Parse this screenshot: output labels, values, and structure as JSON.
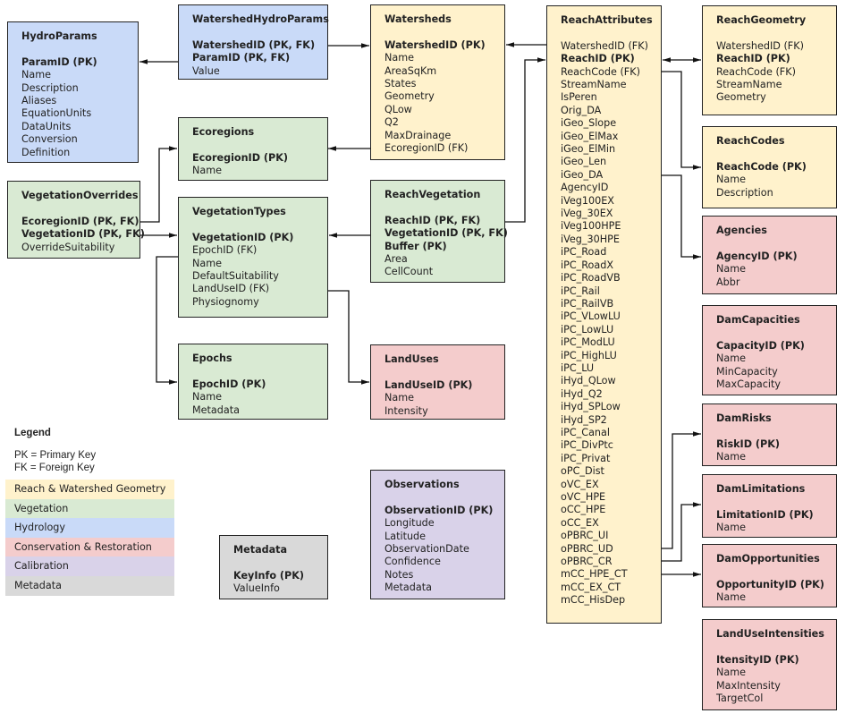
{
  "tables": {
    "hydroparams": {
      "title": "HydroParams",
      "fields": [
        {
          "name": "ParamID (PK)",
          "key": true
        },
        {
          "name": "Name"
        },
        {
          "name": "Description"
        },
        {
          "name": "Aliases"
        },
        {
          "name": "EquationUnits"
        },
        {
          "name": "DataUnits"
        },
        {
          "name": "Conversion"
        },
        {
          "name": "Definition"
        }
      ],
      "category": "hydrology"
    },
    "watershedhydroparams": {
      "title": "WatershedHydroParams",
      "fields": [
        {
          "name": "WatershedID (PK, FK)",
          "key": true
        },
        {
          "name": "ParamID (PK, FK)",
          "key": true
        },
        {
          "name": "Value"
        }
      ],
      "category": "hydrology"
    },
    "watersheds": {
      "title": "Watersheds",
      "fields": [
        {
          "name": "WatershedID (PK)",
          "key": true
        },
        {
          "name": "Name"
        },
        {
          "name": "AreaSqKm"
        },
        {
          "name": "States"
        },
        {
          "name": "Geometry"
        },
        {
          "name": "QLow"
        },
        {
          "name": "Q2"
        },
        {
          "name": "MaxDrainage"
        },
        {
          "name": "EcoregionID (FK)"
        }
      ],
      "category": "geometry"
    },
    "reachattributes": {
      "title": "ReachAttributes",
      "fields": [
        {
          "name": "WatershedID (FK)"
        },
        {
          "name": "ReachID (PK)",
          "key": true
        },
        {
          "name": "ReachCode (FK)"
        },
        {
          "name": "StreamName"
        },
        {
          "name": "IsPeren"
        },
        {
          "name": "Orig_DA"
        },
        {
          "name": "iGeo_Slope"
        },
        {
          "name": "iGeo_ElMax"
        },
        {
          "name": "iGeo_ElMin"
        },
        {
          "name": "iGeo_Len"
        },
        {
          "name": "iGeo_DA"
        },
        {
          "name": "AgencyID"
        },
        {
          "name": "iVeg100EX"
        },
        {
          "name": "iVeg_30EX"
        },
        {
          "name": "iVeg100HPE"
        },
        {
          "name": "iVeg_30HPE"
        },
        {
          "name": "iPC_Road"
        },
        {
          "name": "iPC_RoadX"
        },
        {
          "name": "iPC_RoadVB"
        },
        {
          "name": "iPC_Rail"
        },
        {
          "name": "iPC_RailVB"
        },
        {
          "name": "iPC_VLowLU"
        },
        {
          "name": "iPC_LowLU"
        },
        {
          "name": "iPC_ModLU"
        },
        {
          "name": "iPC_HighLU"
        },
        {
          "name": "iPC_LU"
        },
        {
          "name": "iHyd_QLow"
        },
        {
          "name": "iHyd_Q2"
        },
        {
          "name": "iHyd_SPLow"
        },
        {
          "name": "iHyd_SP2"
        },
        {
          "name": "iPC_Canal"
        },
        {
          "name": "iPC_DivPtc"
        },
        {
          "name": "iPC_Privat"
        },
        {
          "name": "oPC_Dist"
        },
        {
          "name": "oVC_EX"
        },
        {
          "name": "oVC_HPE"
        },
        {
          "name": "oCC_HPE"
        },
        {
          "name": "oCC_EX"
        },
        {
          "name": "oPBRC_UI"
        },
        {
          "name": "oPBRC_UD"
        },
        {
          "name": "oPBRC_CR"
        },
        {
          "name": "mCC_HPE_CT"
        },
        {
          "name": "mCC_EX_CT"
        },
        {
          "name": "mCC_HisDep"
        }
      ],
      "category": "geometry"
    },
    "reachgeometry": {
      "title": "ReachGeometry",
      "fields": [
        {
          "name": "WatershedID (FK)"
        },
        {
          "name": "ReachID (PK)",
          "key": true
        },
        {
          "name": "ReachCode (FK)"
        },
        {
          "name": "StreamName"
        },
        {
          "name": "Geometry"
        }
      ],
      "category": "geometry"
    },
    "reachcodes": {
      "title": "ReachCodes",
      "fields": [
        {
          "name": "ReachCode (PK)",
          "key": true
        },
        {
          "name": "Name"
        },
        {
          "name": "Description"
        }
      ],
      "category": "geometry"
    },
    "agencies": {
      "title": "Agencies",
      "fields": [
        {
          "name": "AgencyID (PK)",
          "key": true
        },
        {
          "name": "Name"
        },
        {
          "name": "Abbr"
        }
      ],
      "category": "conservation"
    },
    "damcapacities": {
      "title": "DamCapacities",
      "fields": [
        {
          "name": "CapacityID (PK)",
          "key": true
        },
        {
          "name": "Name"
        },
        {
          "name": "MinCapacity"
        },
        {
          "name": "MaxCapacity"
        }
      ],
      "category": "conservation"
    },
    "damrisks": {
      "title": "DamRisks",
      "fields": [
        {
          "name": "RiskID (PK)",
          "key": true
        },
        {
          "name": "Name"
        }
      ],
      "category": "conservation"
    },
    "damlimitations": {
      "title": "DamLimitations",
      "fields": [
        {
          "name": "LimitationID (PK)",
          "key": true
        },
        {
          "name": "Name"
        }
      ],
      "category": "conservation"
    },
    "damopportunities": {
      "title": "DamOpportunities",
      "fields": [
        {
          "name": "OpportunityID (PK)",
          "key": true
        },
        {
          "name": "Name"
        }
      ],
      "category": "conservation"
    },
    "landuseintensities": {
      "title": "LandUseIntensities",
      "fields": [
        {
          "name": "ItensityID (PK)",
          "key": true
        },
        {
          "name": "Name"
        },
        {
          "name": "MaxIntensity"
        },
        {
          "name": "TargetCol"
        }
      ],
      "category": "conservation"
    },
    "ecoregions": {
      "title": "Ecoregions",
      "fields": [
        {
          "name": "EcoregionID (PK)",
          "key": true
        },
        {
          "name": "Name"
        }
      ],
      "category": "vegetation"
    },
    "vegetationoverrides": {
      "title": "VegetationOverrides",
      "fields": [
        {
          "name": "EcoregionID (PK, FK)",
          "key": true
        },
        {
          "name": "VegetationID (PK, FK)",
          "key": true
        },
        {
          "name": "OverrideSuitability"
        }
      ],
      "category": "vegetation"
    },
    "vegetationtypes": {
      "title": "VegetationTypes",
      "fields": [
        {
          "name": "VegetationID (PK)",
          "key": true
        },
        {
          "name": "EpochID (FK)"
        },
        {
          "name": "Name"
        },
        {
          "name": "DefaultSuitability"
        },
        {
          "name": "LandUseID (FK)"
        },
        {
          "name": "Physiognomy"
        }
      ],
      "category": "vegetation"
    },
    "reachvegetation": {
      "title": "ReachVegetation",
      "fields": [
        {
          "name": "ReachID (PK, FK)",
          "key": true
        },
        {
          "name": "VegetationID (PK, FK)",
          "key": true
        },
        {
          "name": "Buffer (PK)",
          "key": true
        },
        {
          "name": "Area"
        },
        {
          "name": "CellCount"
        }
      ],
      "category": "vegetation"
    },
    "epochs": {
      "title": "Epochs",
      "fields": [
        {
          "name": "EpochID (PK)",
          "key": true
        },
        {
          "name": "Name"
        },
        {
          "name": "Metadata"
        }
      ],
      "category": "vegetation"
    },
    "landuses": {
      "title": "LandUses",
      "fields": [
        {
          "name": "LandUseID (PK)",
          "key": true
        },
        {
          "name": "Name"
        },
        {
          "name": "Intensity"
        }
      ],
      "category": "conservation"
    },
    "observations": {
      "title": "Observations",
      "fields": [
        {
          "name": "ObservationID (PK)",
          "key": true
        },
        {
          "name": "Longitude"
        },
        {
          "name": "Latitude"
        },
        {
          "name": "ObservationDate"
        },
        {
          "name": "Confidence"
        },
        {
          "name": "Notes"
        },
        {
          "name": "Metadata"
        }
      ],
      "category": "calibration"
    },
    "metadata": {
      "title": "Metadata",
      "fields": [
        {
          "name": "KeyInfo (PK)",
          "key": true
        },
        {
          "name": "ValueInfo"
        }
      ],
      "category": "metadata"
    }
  },
  "relationships": [
    {
      "from": "watershedhydroparams.ParamID",
      "to": "hydroparams.ParamID"
    },
    {
      "from": "watershedhydroparams.WatershedID",
      "to": "watersheds.WatershedID"
    },
    {
      "from": "watersheds.EcoregionID",
      "to": "ecoregions.EcoregionID"
    },
    {
      "from": "reachattributes.WatershedID",
      "to": "watersheds.WatershedID"
    },
    {
      "from": "reachattributes.ReachID",
      "to": "reachgeometry.ReachID",
      "bidirectional": true
    },
    {
      "from": "reachattributes.ReachCode",
      "to": "reachcodes.ReachCode"
    },
    {
      "from": "reachattributes.AgencyID",
      "to": "agencies.AgencyID"
    },
    {
      "from": "reachattributes.oPBRC_UD",
      "to": "damrisks.RiskID"
    },
    {
      "from": "reachattributes.oPBRC_CR",
      "to": "damlimitations.LimitationID"
    },
    {
      "from": "reachattributes.mCC_HPE_CT",
      "to": "damopportunities.OpportunityID"
    },
    {
      "from": "reachvegetation.ReachID",
      "to": "reachattributes.ReachID"
    },
    {
      "from": "reachvegetation.VegetationID",
      "to": "vegetationtypes.VegetationID"
    },
    {
      "from": "vegetationoverrides.EcoregionID",
      "to": "ecoregions.EcoregionID"
    },
    {
      "from": "vegetationoverrides.VegetationID",
      "to": "vegetationtypes.VegetationID"
    },
    {
      "from": "vegetationtypes.EpochID",
      "to": "epochs.EpochID"
    },
    {
      "from": "vegetationtypes.LandUseID",
      "to": "landuses.LandUseID"
    }
  ],
  "legend": {
    "title": "Legend",
    "notes": [
      "PK = Primary Key",
      "FK = Foreign Key"
    ],
    "categories": [
      {
        "label": "Reach & Watershed Geometry",
        "color": "#fff2cc"
      },
      {
        "label": "Vegetation",
        "color": "#d9ead3"
      },
      {
        "label": "Hydrology",
        "color": "#c9daf8"
      },
      {
        "label": "Conservation & Restoration",
        "color": "#f4cccc"
      },
      {
        "label": "Calibration",
        "color": "#d9d2e9"
      },
      {
        "label": "Metadata",
        "color": "#d9d9d9"
      }
    ]
  }
}
